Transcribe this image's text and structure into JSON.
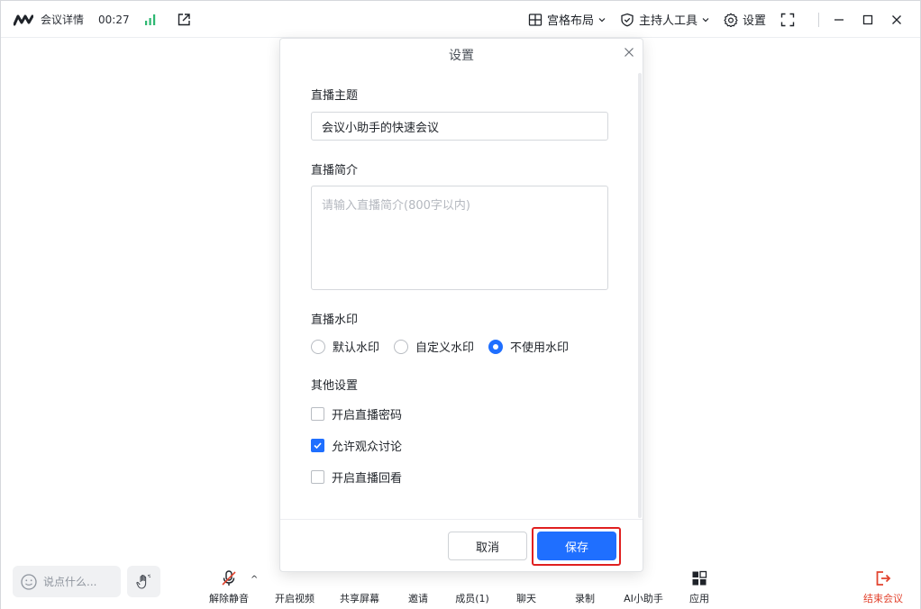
{
  "topbar": {
    "meeting_title": "会议详情",
    "timer": "00:27",
    "layout_label": "宫格布局",
    "host_tools_label": "主持人工具",
    "settings_label": "设置"
  },
  "dialog": {
    "title": "设置",
    "live_topic_label": "直播主题",
    "live_topic_value": "会议小助手的快速会议",
    "live_intro_label": "直播简介",
    "live_intro_placeholder": "请输入直播简介(800字以内)",
    "watermark_label": "直播水印",
    "watermark_options": [
      "默认水印",
      "自定义水印",
      "不使用水印"
    ],
    "watermark_selected": "不使用水印",
    "other_settings_label": "其他设置",
    "checkboxes": [
      {
        "label": "开启直播密码",
        "checked": false
      },
      {
        "label": "允许观众讨论",
        "checked": true
      },
      {
        "label": "开启直播回看",
        "checked": false
      }
    ],
    "cancel_label": "取消",
    "save_label": "保存"
  },
  "bottombar": {
    "chat_placeholder": "说点什么...",
    "tools": [
      "解除静音",
      "开启视频",
      "共享屏幕",
      "邀请",
      "成员(1)",
      "聊天",
      "录制",
      "AI小助手",
      "应用",
      "结束会议"
    ]
  },
  "colors": {
    "accent": "#1f6fff",
    "danger": "#e2432e",
    "signal": "#2eb872",
    "highlight": "#e02020"
  }
}
